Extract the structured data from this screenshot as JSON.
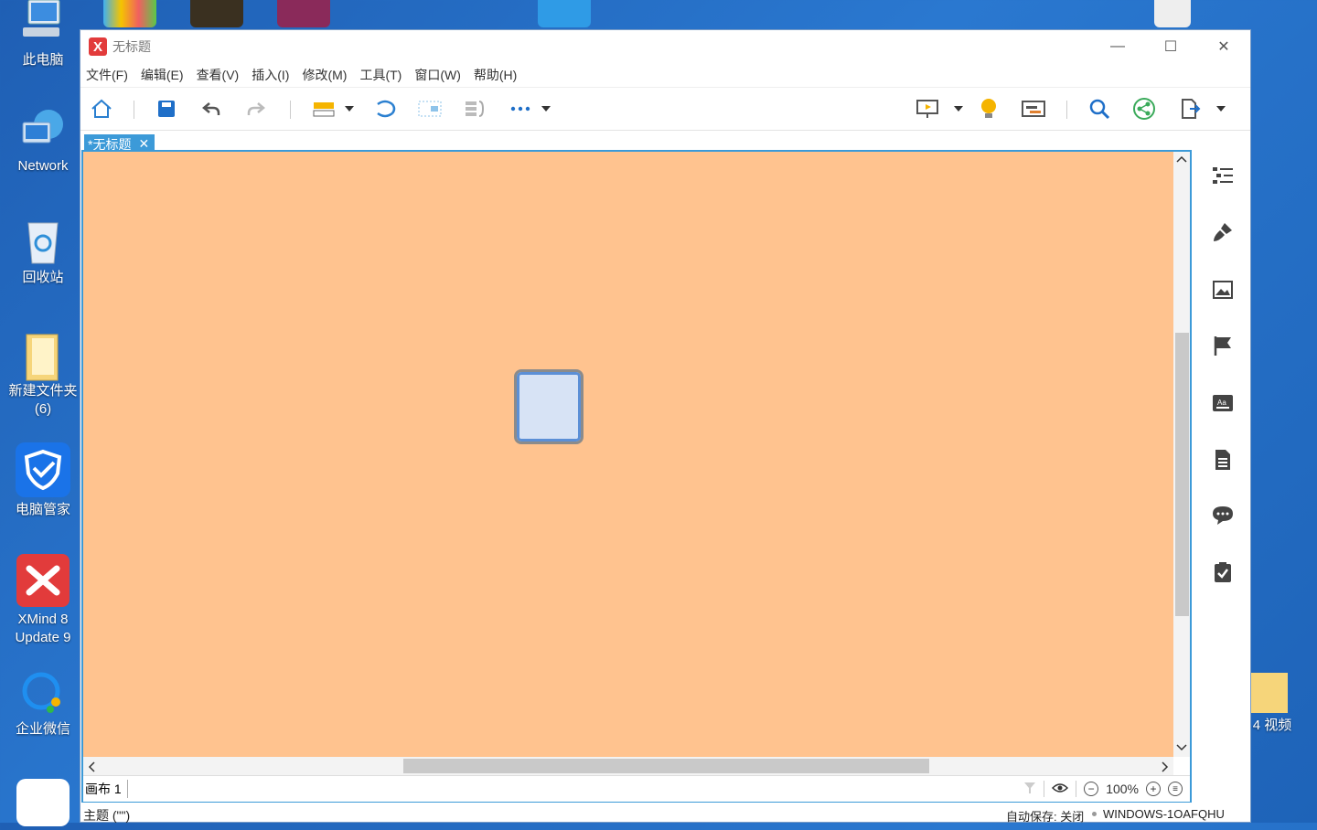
{
  "desktop": {
    "icons": [
      {
        "label": "此电脑",
        "icon": "computer-icon"
      },
      {
        "label": "Network",
        "icon": "network-globe-icon"
      },
      {
        "label": "回收站",
        "icon": "recycle-bin-icon"
      },
      {
        "label": "新建文件夹\n(6)",
        "icon": "folder-icon"
      },
      {
        "label": "电脑管家",
        "icon": "shield-icon"
      },
      {
        "label": "XMind 8\nUpdate 9",
        "icon": "xmind-icon"
      },
      {
        "label": "企业微信",
        "icon": "wecom-icon"
      }
    ],
    "right_icon_label": "4 视频"
  },
  "window": {
    "title": "无标题",
    "logo_glyph": "X",
    "controls": {
      "minimize": "—",
      "maximize": "☐",
      "close": "✕"
    }
  },
  "menu": [
    "文件(F)",
    "编辑(E)",
    "查看(V)",
    "插入(I)",
    "修改(M)",
    "工具(T)",
    "窗口(W)",
    "帮助(H)"
  ],
  "toolbar_icons": [
    "home-icon",
    "save-icon",
    "undo-icon",
    "redo-icon",
    "topic-icon",
    "relationship-icon",
    "boundary-icon",
    "summary-icon",
    "more-icon",
    "presentation-icon",
    "idea-bulb-icon",
    "gantt-icon",
    "search-icon",
    "share-icon",
    "export-icon"
  ],
  "tab": {
    "label": "*无标题",
    "close": "✕"
  },
  "sheet": {
    "label": "画布 1"
  },
  "zoom": {
    "value": "100%",
    "minus": "−",
    "plus": "+"
  },
  "status": {
    "left": "主题 (\"\")",
    "autosave": "自动保存: 关闭",
    "machine": "WINDOWS-1OAFQHU"
  },
  "right_panel_icons": [
    "outline-icon",
    "format-brush-icon",
    "image-icon",
    "marker-flag-icon",
    "text-style-icon",
    "notes-icon",
    "comments-icon",
    "task-icon"
  ],
  "colors": {
    "canvas": "#ffc38f",
    "accent": "#3c9ad8",
    "topic_fill": "#d7e3f5",
    "topic_border": "#5b8fd6"
  }
}
